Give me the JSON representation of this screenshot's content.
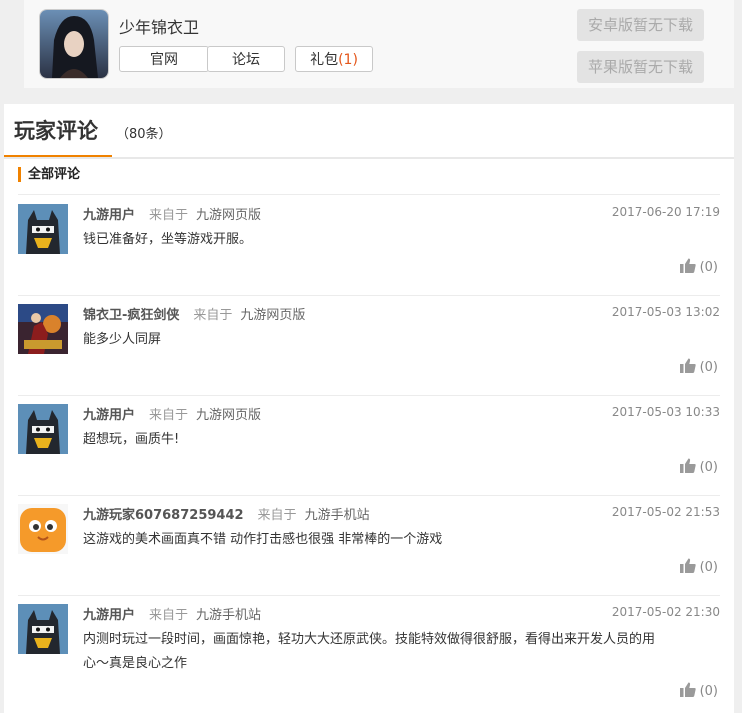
{
  "game": {
    "name": "少年锦衣卫",
    "links": [
      {
        "label": "官网",
        "count": ""
      },
      {
        "label": "论坛",
        "count": ""
      },
      {
        "label": "礼包",
        "count": "(1)"
      }
    ],
    "android_download": "安卓版暂无下载",
    "ios_download": "苹果版暂无下载"
  },
  "comments_section": {
    "title": "玩家评论",
    "count": "（80条）",
    "filter_label": "全部评论"
  },
  "comments": [
    {
      "user": "九游用户",
      "from_label": "来自于",
      "source": "九游网页版",
      "time": "2017-06-20 17:19",
      "text": "钱已准备好，坐等游戏开服。",
      "likes": "(0)",
      "avatar": "ninja-avatar"
    },
    {
      "user": "锦衣卫-疯狂剑侠",
      "from_label": "来自于",
      "source": "九游网页版",
      "time": "2017-05-03 13:02",
      "text": "能多少人同屏",
      "likes": "(0)",
      "avatar": "game-art-avatar"
    },
    {
      "user": "九游用户",
      "from_label": "来自于",
      "source": "九游网页版",
      "time": "2017-05-03 10:33",
      "text": "超想玩，画质牛!",
      "likes": "(0)",
      "avatar": "ninja-avatar"
    },
    {
      "user": "九游玩家607687259442",
      "from_label": "来自于",
      "source": "九游手机站",
      "time": "2017-05-02 21:53",
      "text": "这游戏的美术画面真不错 动作打击感也很强 非常棒的一个游戏",
      "likes": "(0)",
      "avatar": "orange-face-avatar"
    },
    {
      "user": "九游用户",
      "from_label": "来自于",
      "source": "九游手机站",
      "time": "2017-05-02 21:30",
      "text": "内测时玩过一段时间，画面惊艳，轻功大大还原武侠。技能特效做得很舒服，看得出来开发人员的用心～真是良心之作",
      "likes": "(0)",
      "avatar": "ninja-avatar"
    }
  ],
  "colors": {
    "accent": "#f08200",
    "gift_count": "#e4561a"
  },
  "icons": {
    "like": "thumbs-up-icon"
  }
}
